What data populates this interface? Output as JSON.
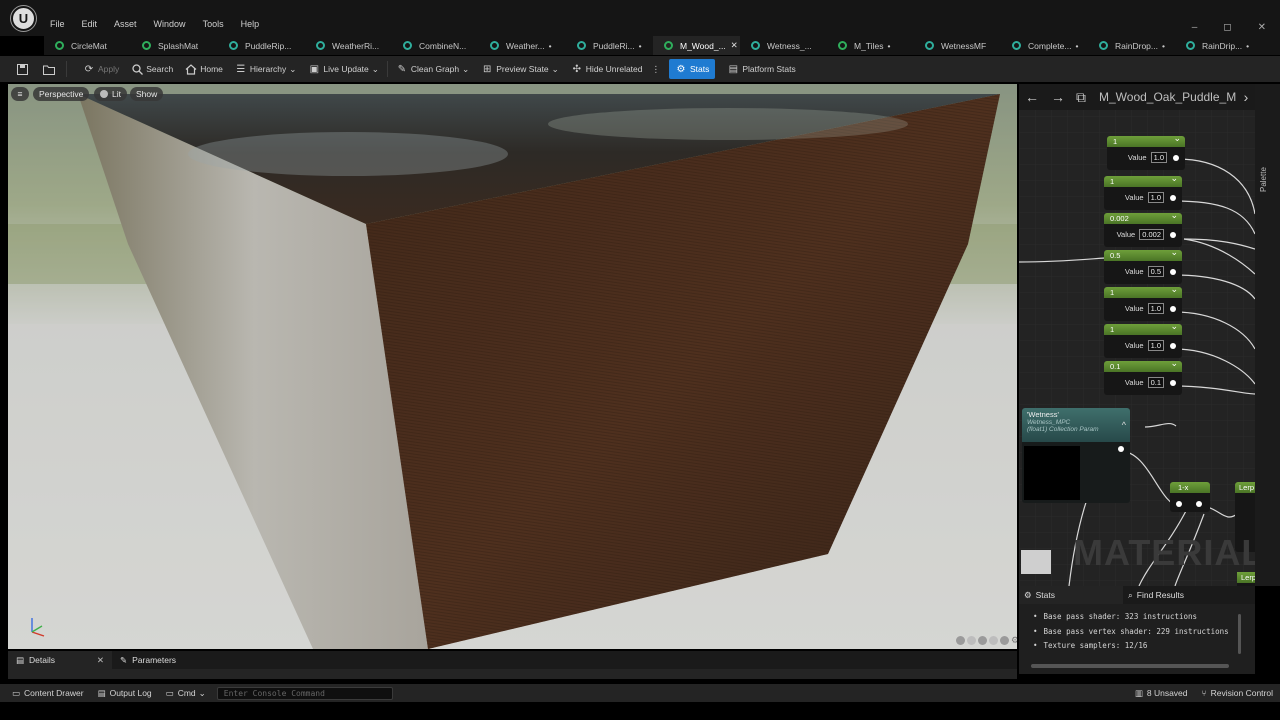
{
  "menu": [
    "File",
    "Edit",
    "Asset",
    "Window",
    "Tools",
    "Help"
  ],
  "window_controls": [
    "–",
    "◻",
    "✕"
  ],
  "tabs": [
    {
      "label": "CircleMat",
      "dirty": false,
      "color": "green"
    },
    {
      "label": "SplashMat",
      "dirty": false,
      "color": "green"
    },
    {
      "label": "PuddleRip...",
      "dirty": false,
      "color": "teal"
    },
    {
      "label": "WeatherRi...",
      "dirty": false,
      "color": "teal"
    },
    {
      "label": "CombineN...",
      "dirty": false,
      "color": "teal"
    },
    {
      "label": "Weather...",
      "dirty": true,
      "color": "teal"
    },
    {
      "label": "PuddleRi...",
      "dirty": true,
      "color": "teal"
    },
    {
      "label": "M_Wood_...",
      "dirty": false,
      "color": "green",
      "active": true
    },
    {
      "label": "Wetness_...",
      "dirty": false,
      "color": "teal"
    },
    {
      "label": "M_Tiles",
      "dirty": true,
      "color": "green"
    },
    {
      "label": "WetnessMF",
      "dirty": false,
      "color": "teal"
    },
    {
      "label": "Complete...",
      "dirty": true,
      "color": "teal"
    },
    {
      "label": "RainDrop...",
      "dirty": true,
      "color": "teal"
    },
    {
      "label": "RainDrip...",
      "dirty": true,
      "color": "teal"
    }
  ],
  "toolbar": {
    "apply": "Apply",
    "search": "Search",
    "home": "Home",
    "hierarchy": "Hierarchy",
    "live_update": "Live Update",
    "clean_graph": "Clean Graph",
    "preview_state": "Preview State",
    "hide_unrelated": "Hide Unrelated",
    "stats": "Stats",
    "platform_stats": "Platform Stats"
  },
  "viewport": {
    "perspective": "Perspective",
    "lit": "Lit",
    "show": "Show"
  },
  "graph": {
    "title": "M_Wood_Oak_Puddle_M",
    "watermark": "MATERIAL",
    "palette": "Palette",
    "nodes": [
      {
        "header": "1",
        "label": "Value",
        "value": "1.0"
      },
      {
        "header": "1",
        "label": "Value",
        "value": "1.0"
      },
      {
        "header": "0.002",
        "label": "Value",
        "value": "0.002"
      },
      {
        "header": "0.5",
        "label": "Value",
        "value": "0.5"
      },
      {
        "header": "1",
        "label": "Value",
        "value": "1.0"
      },
      {
        "header": "1",
        "label": "Value",
        "value": "1.0"
      },
      {
        "header": "0.1",
        "label": "Value",
        "value": "0.1"
      }
    ],
    "wetness_node": {
      "title": "'Wetness'",
      "sub1": "Wetness_MPC",
      "sub2": "(float1) Collection Param"
    },
    "oneminus": "1-x",
    "lerp": "Lerp"
  },
  "stats_panel": {
    "tab_stats": "Stats",
    "tab_find": "Find Results",
    "lines": [
      "Base pass shader: 323 instructions",
      "Base pass vertex shader: 229 instructions",
      "Texture samplers: 12/16"
    ]
  },
  "details": {
    "tab_details": "Details",
    "tab_parameters": "Parameters"
  },
  "statusbar": {
    "content_drawer": "Content Drawer",
    "output_log": "Output Log",
    "cmd": "Cmd",
    "console_placeholder": "Enter Console Command",
    "unsaved": "8 Unsaved",
    "revision_control": "Revision Control"
  }
}
